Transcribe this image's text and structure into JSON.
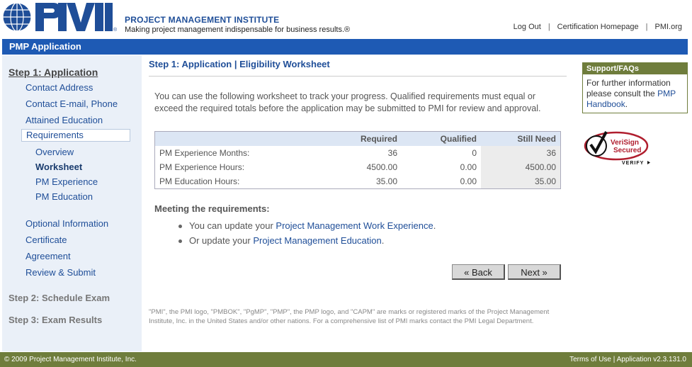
{
  "header": {
    "logo_text": "PMI",
    "org_name": "PROJECT MANAGEMENT INSTITUTE",
    "tagline": "Making project management indispensable for business results.®",
    "links": [
      "Log Out",
      "Certification Homepage",
      "PMI.org"
    ]
  },
  "appbar": {
    "title": "PMP Application"
  },
  "leftnav": {
    "step1": "Step 1: Application",
    "items": [
      "Contact Address",
      "Contact E-mail, Phone",
      "Attained Education"
    ],
    "selected": "Requirements",
    "subitems": [
      "Overview",
      "Worksheet",
      "PM Experience",
      "PM Education"
    ],
    "items2": [
      "Optional Information",
      "Certificate",
      "Agreement",
      "Review & Submit"
    ],
    "step2": "Step 2: Schedule Exam",
    "step3": "Step 3: Exam Results"
  },
  "main": {
    "title": "Step 1: Application | Eligibility Worksheet",
    "intro": "You can use the following worksheet to track your progress. Qualified requirements must equal or exceed the required totals before the application may be submitted to PMI for review and approval.",
    "table": {
      "headers": [
        "",
        "Required",
        "Qualified",
        "Still Need"
      ],
      "rows": [
        [
          "PM Experience Months:",
          "36",
          "0",
          "36"
        ],
        [
          "PM Experience Hours:",
          "4500.00",
          "0.00",
          "4500.00"
        ],
        [
          "PM Education Hours:",
          "35.00",
          "0.00",
          "35.00"
        ]
      ]
    },
    "meeting_heading": "Meeting the requirements:",
    "bullet1_prefix": "You can update your ",
    "bullet1_link": "Project Management Work Experience",
    "bullet1_suffix": ".",
    "bullet2_prefix": "Or update your ",
    "bullet2_link": "Project Management Education",
    "bullet2_suffix": ".",
    "back_label": "« Back",
    "next_label": "Next »",
    "footnote": "\"PMI\", the PMI logo, \"PMBOK\", \"PgMP\", \"PMP\", the PMP logo, and \"CAPM\" are marks or registered marks of the Project Management Institute, Inc. in the United States and/or other nations. For a comprehensive list of PMI marks contact the PMI Legal Department."
  },
  "support": {
    "heading": "Support/FAQs",
    "text": "For further information please consult the ",
    "link": "PMP Handbook",
    "suffix": "."
  },
  "verisign": {
    "line1": "VeriSign",
    "line2": "Secured",
    "verify": "VERIFY"
  },
  "footer": {
    "copyright": "© 2009 Project Management Institute, Inc.",
    "right": "Terms of Use | Application v2.3.131.0"
  }
}
